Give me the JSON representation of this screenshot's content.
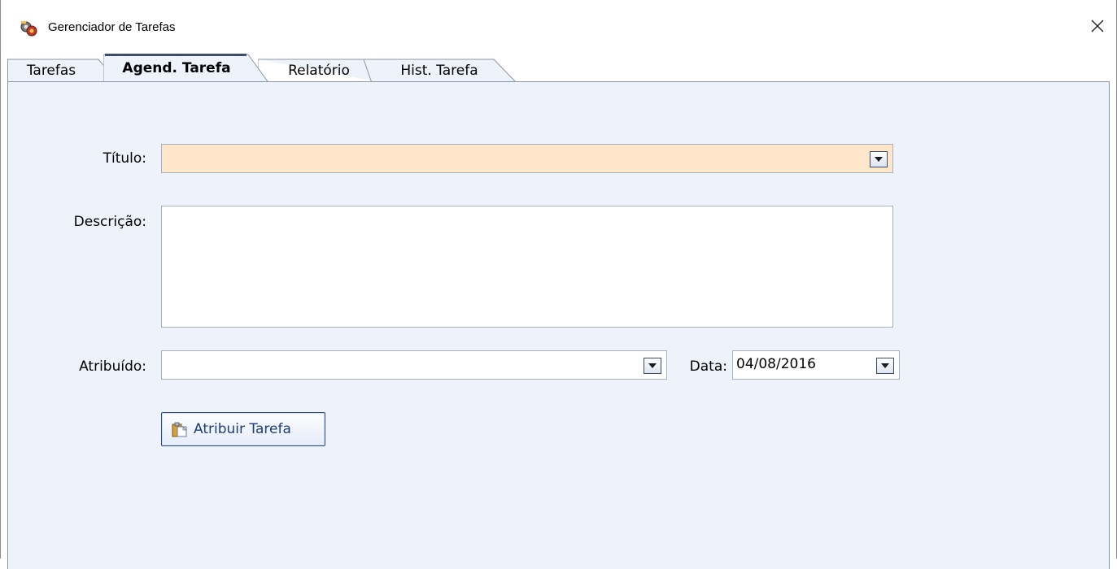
{
  "window": {
    "title": "Gerenciador de Tarefas",
    "close_glyph": "✕"
  },
  "tabs": [
    {
      "label": "Tarefas",
      "active": false
    },
    {
      "label": "Agend. Tarefa",
      "active": true
    },
    {
      "label": "Relatório",
      "active": false
    },
    {
      "label": "Hist. Tarefa",
      "active": false
    }
  ],
  "form": {
    "titulo_label": "Título:",
    "titulo_value": "",
    "descricao_label": "Descrição:",
    "descricao_value": "",
    "atribuido_label": "Atribuído:",
    "atribuido_value": "",
    "data_label": "Data:",
    "data_value": "04/08/2016",
    "submit_label": "Atribuir Tarefa"
  },
  "colors": {
    "panel_bg": "#eef3fb",
    "titulo_bg": "#fde6c9",
    "button_text": "#1d3d7a"
  },
  "icons": {
    "app": "gears-app-icon",
    "close": "close-icon",
    "dropdown": "chevron-down-icon",
    "submit": "clipboard-icon"
  }
}
